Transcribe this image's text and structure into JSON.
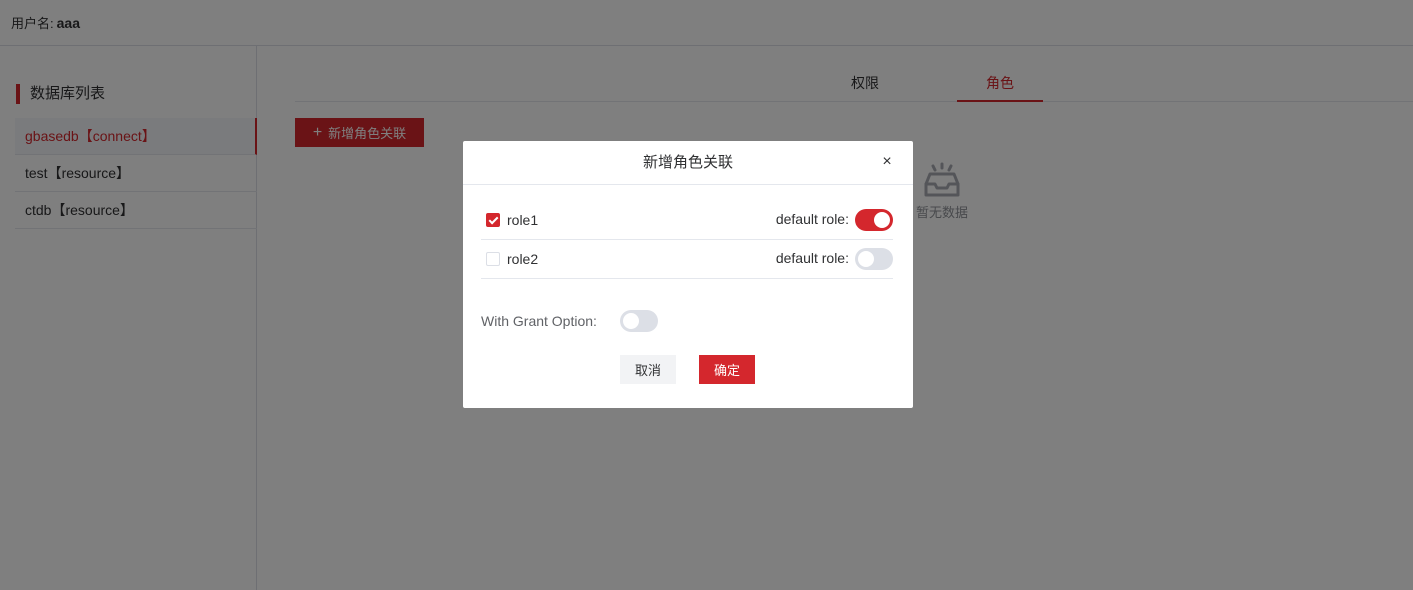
{
  "header": {
    "user_label": "用户名:",
    "username": "aaa"
  },
  "sidebar": {
    "title": "数据库列表",
    "items": [
      {
        "label": "gbasedb【connect】",
        "active": true
      },
      {
        "label": "test【resource】",
        "active": false
      },
      {
        "label": "ctdb【resource】",
        "active": false
      }
    ]
  },
  "main": {
    "tabs": [
      {
        "label": "权限",
        "active": false
      },
      {
        "label": "角色",
        "active": true
      }
    ],
    "add_button_label": "新增角色关联",
    "empty_text": "暂无数据"
  },
  "dialog": {
    "title": "新增角色关联",
    "close_symbol": "×",
    "roles": [
      {
        "name": "role1",
        "checked": true,
        "default_label": "default role:",
        "default_on": true
      },
      {
        "name": "role2",
        "checked": false,
        "default_label": "default role:",
        "default_on": false
      }
    ],
    "grant_label": "With Grant Option:",
    "grant_on": false,
    "cancel_label": "取消",
    "ok_label": "确定"
  },
  "colors": {
    "accent": "#d4272d",
    "mask": "rgba(0,0,0,0.5)"
  },
  "icons": [
    "plus-icon",
    "empty-inbox-icon",
    "close-icon",
    "check-icon"
  ]
}
